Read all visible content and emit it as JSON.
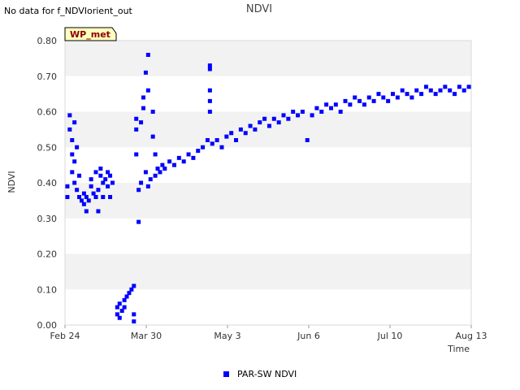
{
  "status_text": "No data for f_NDVIorient_out",
  "badge": "WP_met",
  "chart_data": {
    "type": "scatter",
    "title": "NDVI",
    "xlabel": "Time",
    "ylabel": "NDVI",
    "ylim": [
      0.0,
      0.8
    ],
    "yticks": [
      "0.00",
      "0.10",
      "0.20",
      "0.30",
      "0.40",
      "0.50",
      "0.60",
      "0.70",
      "0.80"
    ],
    "x_axis_type": "date",
    "xlim": [
      "2024-02-24",
      "2024-08-13"
    ],
    "xticks": [
      "Feb 24",
      "Mar 30",
      "May 3",
      "Jun 6",
      "Jul 10",
      "Aug 13"
    ],
    "grid": "alternating horizontal bands",
    "legend_position": "bottom-center",
    "series": [
      {
        "name": "PAR-SW NDVI",
        "color": "#0000ff",
        "marker": "square",
        "points": [
          [
            "2024-02-25",
            0.39
          ],
          [
            "2024-02-25",
            0.36
          ],
          [
            "2024-02-26",
            0.59
          ],
          [
            "2024-02-26",
            0.55
          ],
          [
            "2024-02-27",
            0.52
          ],
          [
            "2024-02-27",
            0.43
          ],
          [
            "2024-02-27",
            0.48
          ],
          [
            "2024-02-28",
            0.57
          ],
          [
            "2024-02-28",
            0.46
          ],
          [
            "2024-02-28",
            0.4
          ],
          [
            "2024-02-29",
            0.5
          ],
          [
            "2024-02-29",
            0.38
          ],
          [
            "2024-03-01",
            0.36
          ],
          [
            "2024-03-01",
            0.42
          ],
          [
            "2024-03-02",
            0.35
          ],
          [
            "2024-03-03",
            0.37
          ],
          [
            "2024-03-03",
            0.34
          ],
          [
            "2024-03-04",
            0.32
          ],
          [
            "2024-03-04",
            0.36
          ],
          [
            "2024-03-05",
            0.35
          ],
          [
            "2024-03-06",
            0.39
          ],
          [
            "2024-03-06",
            0.41
          ],
          [
            "2024-03-07",
            0.37
          ],
          [
            "2024-03-08",
            0.43
          ],
          [
            "2024-03-08",
            0.36
          ],
          [
            "2024-03-09",
            0.32
          ],
          [
            "2024-03-09",
            0.38
          ],
          [
            "2024-03-10",
            0.42
          ],
          [
            "2024-03-10",
            0.44
          ],
          [
            "2024-03-11",
            0.4
          ],
          [
            "2024-03-11",
            0.36
          ],
          [
            "2024-03-12",
            0.41
          ],
          [
            "2024-03-13",
            0.43
          ],
          [
            "2024-03-13",
            0.39
          ],
          [
            "2024-03-14",
            0.36
          ],
          [
            "2024-03-14",
            0.42
          ],
          [
            "2024-03-15",
            0.4
          ],
          [
            "2024-03-17",
            0.05
          ],
          [
            "2024-03-17",
            0.03
          ],
          [
            "2024-03-18",
            0.06
          ],
          [
            "2024-03-18",
            0.02
          ],
          [
            "2024-03-19",
            0.04
          ],
          [
            "2024-03-20",
            0.07
          ],
          [
            "2024-03-20",
            0.05
          ],
          [
            "2024-03-21",
            0.08
          ],
          [
            "2024-03-22",
            0.09
          ],
          [
            "2024-03-23",
            0.1
          ],
          [
            "2024-03-24",
            0.11
          ],
          [
            "2024-03-24",
            0.03
          ],
          [
            "2024-03-24",
            0.01
          ],
          [
            "2024-03-25",
            0.58
          ],
          [
            "2024-03-25",
            0.48
          ],
          [
            "2024-03-25",
            0.55
          ],
          [
            "2024-03-26",
            0.29
          ],
          [
            "2024-03-26",
            0.38
          ],
          [
            "2024-03-27",
            0.4
          ],
          [
            "2024-03-27",
            0.57
          ],
          [
            "2024-03-28",
            0.64
          ],
          [
            "2024-03-28",
            0.61
          ],
          [
            "2024-03-29",
            0.71
          ],
          [
            "2024-03-29",
            0.43
          ],
          [
            "2024-03-30",
            0.76
          ],
          [
            "2024-03-30",
            0.66
          ],
          [
            "2024-03-30",
            0.39
          ],
          [
            "2024-03-31",
            0.41
          ],
          [
            "2024-04-01",
            0.6
          ],
          [
            "2024-04-01",
            0.53
          ],
          [
            "2024-04-02",
            0.42
          ],
          [
            "2024-04-02",
            0.48
          ],
          [
            "2024-04-03",
            0.44
          ],
          [
            "2024-04-04",
            0.43
          ],
          [
            "2024-04-05",
            0.45
          ],
          [
            "2024-04-06",
            0.44
          ],
          [
            "2024-04-08",
            0.46
          ],
          [
            "2024-04-10",
            0.45
          ],
          [
            "2024-04-12",
            0.47
          ],
          [
            "2024-04-14",
            0.46
          ],
          [
            "2024-04-16",
            0.48
          ],
          [
            "2024-04-18",
            0.47
          ],
          [
            "2024-04-20",
            0.49
          ],
          [
            "2024-04-22",
            0.5
          ],
          [
            "2024-04-24",
            0.52
          ],
          [
            "2024-04-25",
            0.73
          ],
          [
            "2024-04-25",
            0.72
          ],
          [
            "2024-04-25",
            0.66
          ],
          [
            "2024-04-25",
            0.63
          ],
          [
            "2024-04-25",
            0.6
          ],
          [
            "2024-04-26",
            0.51
          ],
          [
            "2024-04-28",
            0.52
          ],
          [
            "2024-04-30",
            0.5
          ],
          [
            "2024-05-02",
            0.53
          ],
          [
            "2024-05-04",
            0.54
          ],
          [
            "2024-05-06",
            0.52
          ],
          [
            "2024-05-08",
            0.55
          ],
          [
            "2024-05-10",
            0.54
          ],
          [
            "2024-05-12",
            0.56
          ],
          [
            "2024-05-14",
            0.55
          ],
          [
            "2024-05-16",
            0.57
          ],
          [
            "2024-05-18",
            0.58
          ],
          [
            "2024-05-20",
            0.56
          ],
          [
            "2024-05-22",
            0.58
          ],
          [
            "2024-05-24",
            0.57
          ],
          [
            "2024-05-26",
            0.59
          ],
          [
            "2024-05-28",
            0.58
          ],
          [
            "2024-05-30",
            0.6
          ],
          [
            "2024-06-01",
            0.59
          ],
          [
            "2024-06-03",
            0.6
          ],
          [
            "2024-06-05",
            0.52
          ],
          [
            "2024-06-07",
            0.59
          ],
          [
            "2024-06-09",
            0.61
          ],
          [
            "2024-06-11",
            0.6
          ],
          [
            "2024-06-13",
            0.62
          ],
          [
            "2024-06-15",
            0.61
          ],
          [
            "2024-06-17",
            0.62
          ],
          [
            "2024-06-19",
            0.6
          ],
          [
            "2024-06-21",
            0.63
          ],
          [
            "2024-06-23",
            0.62
          ],
          [
            "2024-06-25",
            0.64
          ],
          [
            "2024-06-27",
            0.63
          ],
          [
            "2024-06-29",
            0.62
          ],
          [
            "2024-07-01",
            0.64
          ],
          [
            "2024-07-03",
            0.63
          ],
          [
            "2024-07-05",
            0.65
          ],
          [
            "2024-07-07",
            0.64
          ],
          [
            "2024-07-09",
            0.63
          ],
          [
            "2024-07-11",
            0.65
          ],
          [
            "2024-07-13",
            0.64
          ],
          [
            "2024-07-15",
            0.66
          ],
          [
            "2024-07-17",
            0.65
          ],
          [
            "2024-07-19",
            0.64
          ],
          [
            "2024-07-21",
            0.66
          ],
          [
            "2024-07-23",
            0.65
          ],
          [
            "2024-07-25",
            0.67
          ],
          [
            "2024-07-27",
            0.66
          ],
          [
            "2024-07-29",
            0.65
          ],
          [
            "2024-07-31",
            0.66
          ],
          [
            "2024-08-02",
            0.67
          ],
          [
            "2024-08-04",
            0.66
          ],
          [
            "2024-08-06",
            0.65
          ],
          [
            "2024-08-08",
            0.67
          ],
          [
            "2024-08-10",
            0.66
          ],
          [
            "2024-08-12",
            0.67
          ]
        ]
      }
    ]
  }
}
